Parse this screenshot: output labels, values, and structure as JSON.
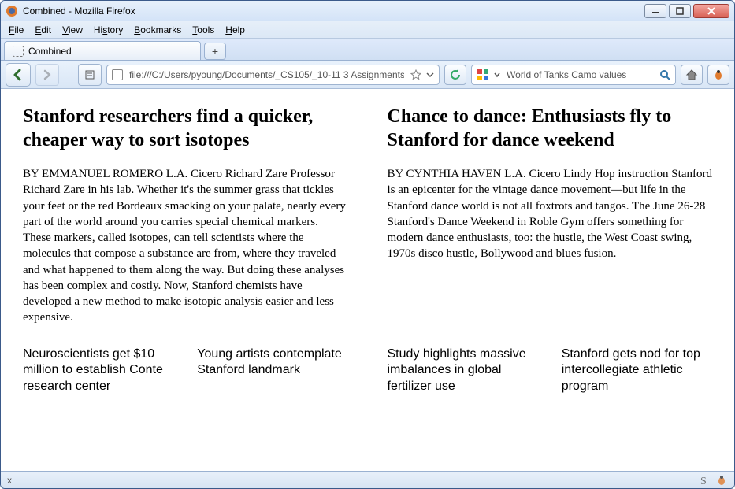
{
  "window": {
    "title": "Combined - Mozilla Firefox"
  },
  "menu": {
    "file": "File",
    "edit": "Edit",
    "view": "View",
    "history": "History",
    "bookmarks": "Bookmarks",
    "tools": "Tools",
    "help": "Help"
  },
  "tab": {
    "label": "Combined"
  },
  "url": {
    "value": "file:///C:/Users/pyoung/Documents/_CS105/_10-11 3 Assignments/…"
  },
  "search": {
    "value": "World of Tanks Camo values"
  },
  "articles": {
    "left": {
      "headline": "Stanford researchers find a quicker, cheaper way to sort isotopes",
      "body": "BY EMMANUEL ROMERO L.A. Cicero Richard Zare Professor Richard Zare in his lab. Whether it's the summer grass that tickles your feet or the red Bordeaux smacking on your palate, nearly every part of the world around you carries special chemical markers. These markers, called isotopes, can tell scientists where the molecules that compose a substance are from, where they traveled and what happened to them along the way. But doing these analyses has been complex and costly. Now, Stanford chemists have developed a new method to make isotopic analysis easier and less expensive."
    },
    "right": {
      "headline": "Chance to dance: Enthusiasts fly to Stanford for dance weekend",
      "body": "BY CYNTHIA HAVEN L.A. Cicero Lindy Hop instruction Stanford is an epicenter for the vintage dance movement—but life in the Stanford dance world is not all foxtrots and tangos. The June 26-28 Stanford's Dance Weekend in Roble Gym offers something for modern dance enthusiasts, too: the hustle, the West Coast swing, 1970s disco hustle, Bollywood and blues fusion."
    }
  },
  "subs": {
    "a": "Neuroscientists get $10 million to establish Conte research center",
    "b": "Young artists contemplate Stanford landmark",
    "c": "Study highlights massive imbalances in global fertilizer use",
    "d": "Stanford gets nod for top intercollegiate athletic program"
  },
  "status": {
    "x": "x"
  }
}
